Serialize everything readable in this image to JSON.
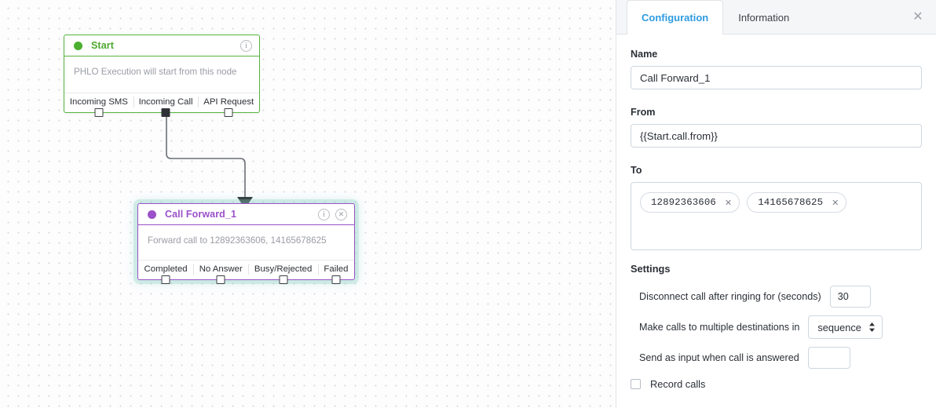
{
  "canvas": {
    "nodes": [
      {
        "id": "start",
        "title": "Start",
        "accent": "#4ca82f",
        "body": "PHLO Execution will start from this node",
        "info_icon": "info-icon",
        "ports": [
          {
            "label": "Incoming SMS",
            "connected": false
          },
          {
            "label": "Incoming Call",
            "connected": true
          },
          {
            "label": "API Request",
            "connected": false
          }
        ]
      },
      {
        "id": "call-forward",
        "title": "Call Forward_1",
        "accent": "#9b51c9",
        "body": "Forward call to 12892363606, 14165678625",
        "info_icon": "info-icon",
        "close_icon": "close-circle-icon",
        "ports": [
          {
            "label": "Completed",
            "connected": false
          },
          {
            "label": "No Answer",
            "connected": false
          },
          {
            "label": "Busy/Rejected",
            "connected": false
          },
          {
            "label": "Failed",
            "connected": false
          }
        ]
      }
    ],
    "connector": {
      "color": "#6b6f76",
      "from_port": "Incoming Call",
      "to_node": "Call Forward_1"
    }
  },
  "panel": {
    "tabs": [
      {
        "label": "Configuration",
        "active": true
      },
      {
        "label": "Information",
        "active": false
      }
    ],
    "close_label": "✕",
    "accent_color": "#2e9be0",
    "name": {
      "label": "Name",
      "value": "Call Forward_1"
    },
    "from": {
      "label": "From",
      "value": "{{Start.call.from}}"
    },
    "to": {
      "label": "To",
      "chips": [
        {
          "value": "12892363606",
          "remove": "✕"
        },
        {
          "value": "14165678625",
          "remove": "✕"
        }
      ]
    },
    "settings": {
      "title": "Settings",
      "disconnect": {
        "label": "Disconnect call after ringing for (seconds)",
        "value": "30"
      },
      "multi_destination": {
        "label": "Make calls to multiple destinations in",
        "value": "sequence"
      },
      "send_input": {
        "label": "Send as input when call is answered",
        "value": ""
      },
      "record": {
        "label": "Record calls",
        "checked": false
      }
    }
  }
}
